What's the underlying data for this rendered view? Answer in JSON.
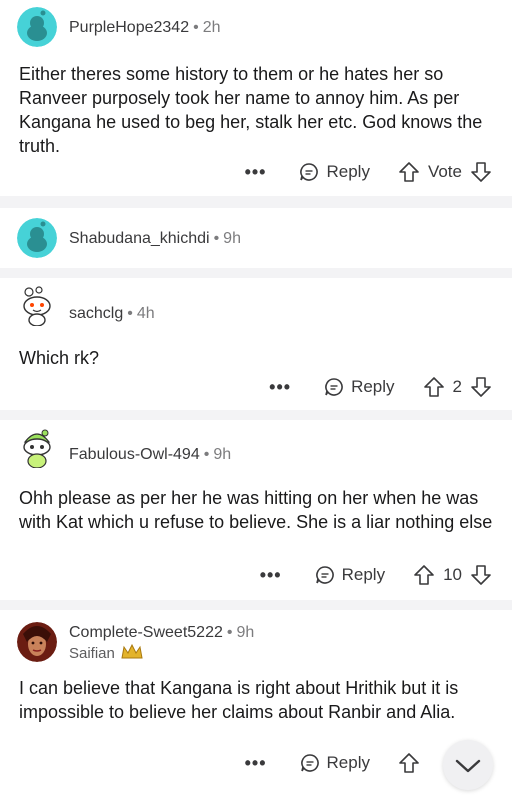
{
  "comments": [
    {
      "username": "PurpleHope2342",
      "time": "2h",
      "body": "Either theres some history to them or he hates her so Ranveer purposely took her name to annoy him. As per Kangana he used to beg her, stalk her etc. God knows the truth.",
      "more": "•••",
      "reply": "Reply",
      "vote": "Vote"
    },
    {
      "username": "Shabudana_khichdi",
      "time": "9h"
    },
    {
      "username": "sachclg",
      "time": "4h",
      "body": "Which rk?",
      "more": "•••",
      "reply": "Reply",
      "vote": "2"
    },
    {
      "username": "Fabulous-Owl-494",
      "time": "9h",
      "body": "Ohh please as per her he was hitting on her when he was with Kat which u refuse to believe. She is a liar nothing else",
      "more": "•••",
      "reply": "Reply",
      "vote": "10"
    },
    {
      "username": "Complete-Sweet5222",
      "time": "9h",
      "flair": "Saifian",
      "body": "I can believe that Kangana is right about Hrithik but it is impossible to believe her claims about Ranbir and Alia.",
      "more": "•••",
      "reply": "Reply"
    }
  ],
  "separator_dot": "•",
  "colors": {
    "avatar_teal": "#46d2d7",
    "separator": "#f3f3f5",
    "upvote": "#3a3a3c"
  }
}
